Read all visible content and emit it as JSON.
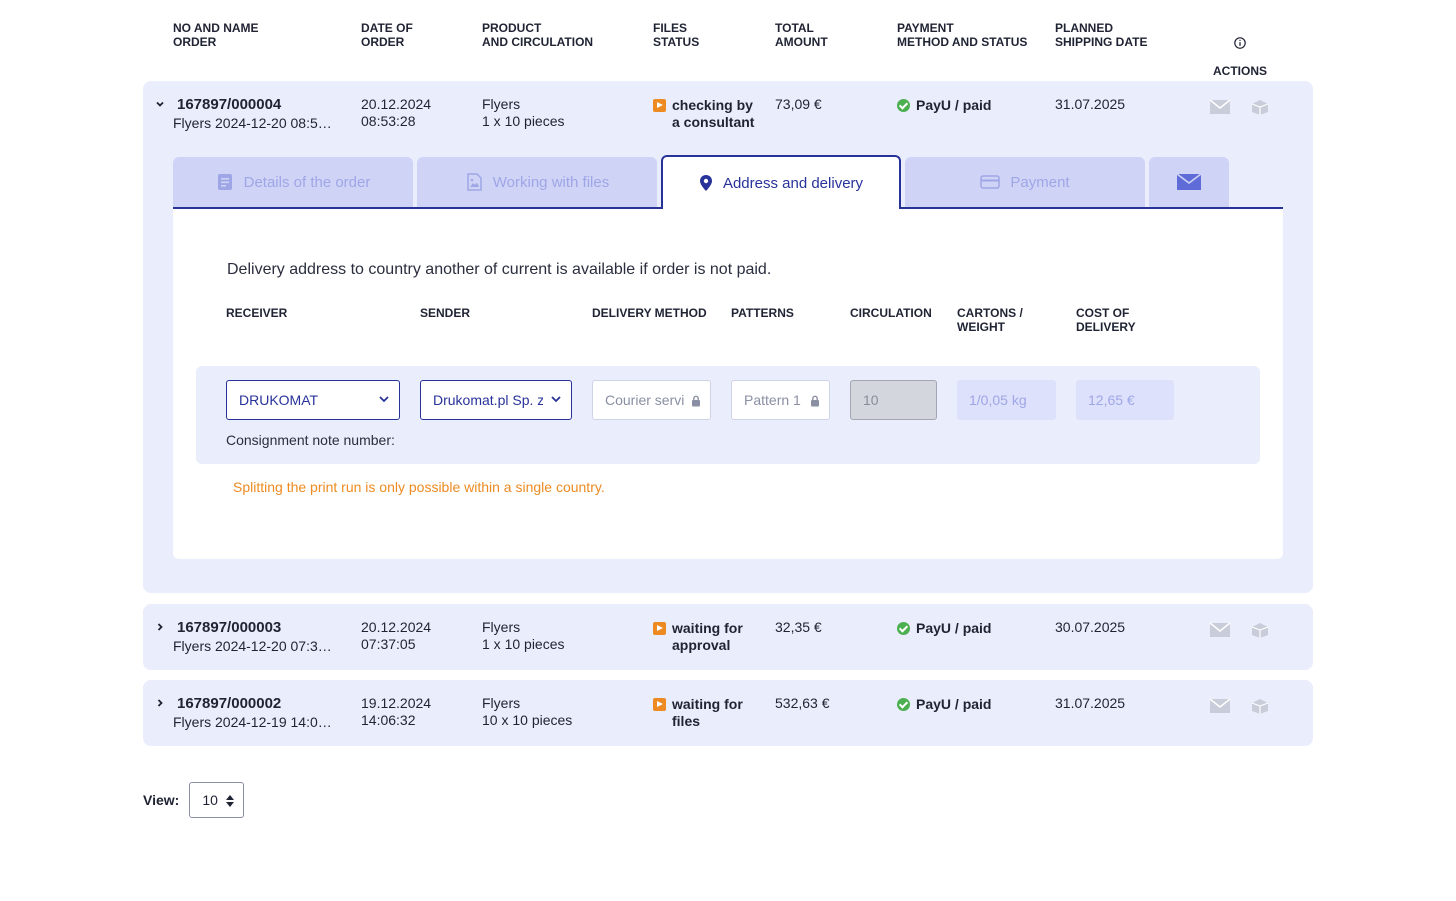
{
  "headers": {
    "order": "NO AND NAME\nORDER",
    "date": "DATE OF\nORDER",
    "product": "PRODUCT\nAND CIRCULATION",
    "files": "FILES\nSTATUS",
    "total": "TOTAL\nAMOUNT",
    "payment": "PAYMENT\nMETHOD AND STATUS",
    "shipping": "PLANNED\nSHIPPING DATE",
    "actions": "ACTIONS"
  },
  "orders": [
    {
      "number": "167897/000004",
      "name": "Flyers 2024-12-20 08:5…",
      "date": "20.12.2024\n08:53:28",
      "product": "Flyers\n1 x 10 pieces",
      "files_status": "checking by\na consultant",
      "total": "73,09 €",
      "payment": "PayU / paid",
      "shipping": "31.07.2025",
      "expanded": true
    },
    {
      "number": "167897/000003",
      "name": "Flyers 2024-12-20 07:3…",
      "date": "20.12.2024\n07:37:05",
      "product": "Flyers\n1 x 10 pieces",
      "files_status": "waiting for\napproval",
      "total": "32,35 €",
      "payment": "PayU / paid",
      "shipping": "30.07.2025",
      "expanded": false
    },
    {
      "number": "167897/000002",
      "name": "Flyers 2024-12-19 14:0…",
      "date": "19.12.2024\n14:06:32",
      "product": "Flyers\n10 x 10 pieces",
      "files_status": "waiting for\nfiles",
      "total": "532,63 €",
      "payment": "PayU / paid",
      "shipping": "31.07.2025",
      "expanded": false
    }
  ],
  "tabs": {
    "details": "Details of the order",
    "files": "Working with files",
    "address": "Address and delivery",
    "payment": "Payment",
    "active": "address"
  },
  "delivery": {
    "note": "Delivery address to country another of current is available if order is not paid.",
    "columns": {
      "receiver": "RECEIVER",
      "sender": "SENDER",
      "method": "DELIVERY METHOD",
      "patterns": "PATTERNS",
      "circulation": "CIRCULATION",
      "cartons": "CARTONS /\nWEIGHT",
      "cost": "COST OF\nDELIVERY"
    },
    "receiver": "DRUKOMAT",
    "sender": "Drukomat.pl Sp. z o.o.",
    "method": "Courier service",
    "pattern": "Pattern 1",
    "circulation": "10",
    "cartons_weight": "1/0,05 kg",
    "cost": "12,65 €",
    "consignment_label": "Consignment note number:",
    "warning": "Splitting the print run is only possible within a single country."
  },
  "pagination": {
    "view_label": "View:",
    "view_value": "10"
  },
  "colors": {
    "accent": "#28339a",
    "row_bg": "#eaedfc",
    "status_orange": "#ed8b22",
    "paid_green": "#4caf50"
  }
}
